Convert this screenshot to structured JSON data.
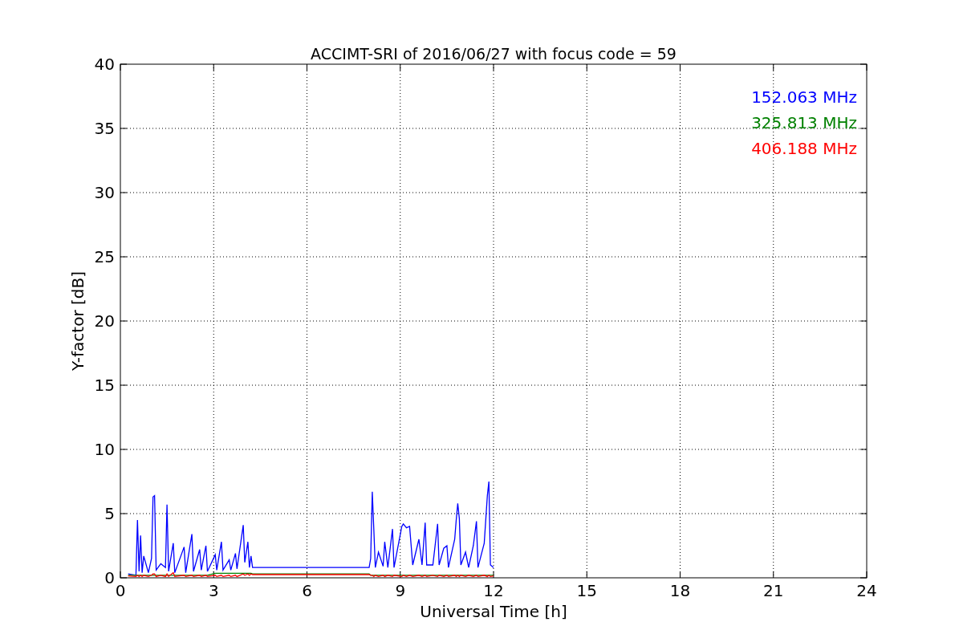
{
  "plot": {
    "chart_data": {
      "type": "line",
      "title": "ACCIMT-SRI of 2016/06/27 with focus code = 59",
      "xlabel": "Universal Time [h]",
      "ylabel": "Y-factor [dB]",
      "x": [
        0.25,
        0.5,
        0.55,
        0.6,
        0.65,
        0.7,
        0.75,
        0.9,
        1.0,
        1.05,
        1.1,
        1.15,
        1.3,
        1.45,
        1.5,
        1.55,
        1.7,
        1.75,
        2.05,
        2.1,
        2.3,
        2.35,
        2.55,
        2.6,
        2.75,
        2.8,
        3.05,
        3.1,
        3.25,
        3.3,
        3.5,
        3.55,
        3.7,
        3.75,
        3.95,
        4.0,
        4.1,
        4.15,
        4.2,
        4.25,
        8.0,
        8.05,
        8.1,
        8.15,
        8.2,
        8.3,
        8.45,
        8.5,
        8.6,
        8.75,
        8.8,
        9.05,
        9.1,
        9.2,
        9.3,
        9.4,
        9.6,
        9.7,
        9.8,
        9.85,
        10.05,
        10.2,
        10.25,
        10.4,
        10.5,
        10.55,
        10.75,
        10.8,
        10.85,
        10.9,
        10.95,
        11.1,
        11.2,
        11.35,
        11.45,
        11.5,
        11.7,
        11.8,
        11.85,
        11.9,
        12.0
      ],
      "series": [
        {
          "name": "152.063 MHz",
          "color": "#0000ff",
          "values": [
            0.3,
            0.2,
            4.5,
            0.5,
            3.3,
            0.4,
            1.7,
            0.4,
            1.5,
            6.3,
            6.4,
            0.6,
            1.1,
            0.8,
            5.7,
            0.5,
            2.7,
            0.4,
            2.4,
            0.4,
            3.4,
            0.5,
            2.2,
            0.6,
            2.5,
            0.5,
            1.8,
            0.6,
            2.8,
            0.6,
            1.4,
            0.6,
            1.9,
            0.7,
            4.1,
            1.2,
            2.8,
            0.8,
            1.7,
            0.8,
            0.8,
            1.5,
            6.7,
            3.8,
            0.8,
            2.0,
            0.9,
            2.8,
            0.8,
            3.8,
            0.8,
            4.0,
            4.2,
            3.9,
            4.0,
            1.0,
            3.0,
            1.0,
            4.3,
            1.0,
            1.0,
            4.2,
            1.0,
            2.3,
            2.5,
            0.8,
            3.0,
            4.5,
            5.8,
            4.6,
            1.0,
            2.0,
            0.8,
            2.5,
            4.4,
            0.8,
            2.7,
            6.4,
            7.5,
            1.0,
            0.8
          ]
        },
        {
          "name": "325.813 MHz",
          "color": "#008000",
          "values": [
            0.2,
            0.2,
            0.2,
            0.2,
            0.2,
            0.2,
            0.2,
            0.2,
            0.2,
            0.2,
            0.2,
            0.2,
            0.2,
            0.2,
            0.2,
            0.2,
            0.2,
            0.2,
            0.2,
            0.2,
            0.2,
            0.2,
            0.2,
            0.2,
            0.2,
            0.2,
            0.35,
            0.35,
            0.35,
            0.35,
            0.35,
            0.35,
            0.35,
            0.35,
            0.35,
            0.35,
            0.35,
            0.35,
            0.35,
            0.3,
            0.3,
            0.2,
            0.2,
            0.2,
            0.2,
            0.2,
            0.2,
            0.2,
            0.2,
            0.2,
            0.2,
            0.2,
            0.2,
            0.2,
            0.2,
            0.2,
            0.2,
            0.2,
            0.2,
            0.2,
            0.2,
            0.2,
            0.2,
            0.2,
            0.2,
            0.2,
            0.2,
            0.2,
            0.2,
            0.2,
            0.2,
            0.2,
            0.2,
            0.2,
            0.2,
            0.2,
            0.2,
            0.2,
            0.2,
            0.2,
            0.2
          ]
        },
        {
          "name": "406.188 MHz",
          "color": "#ff0000",
          "values": [
            0.15,
            0.1,
            0.2,
            0.1,
            0.2,
            0.1,
            0.2,
            0.1,
            0.2,
            0.3,
            0.3,
            0.1,
            0.2,
            0.1,
            0.3,
            0.1,
            0.4,
            0.1,
            0.2,
            0.1,
            0.2,
            0.1,
            0.2,
            0.1,
            0.2,
            0.1,
            0.2,
            0.1,
            0.2,
            0.1,
            0.2,
            0.1,
            0.2,
            0.1,
            0.3,
            0.2,
            0.3,
            0.2,
            0.3,
            0.25,
            0.25,
            0.2,
            0.2,
            0.1,
            0.2,
            0.1,
            0.2,
            0.1,
            0.2,
            0.1,
            0.2,
            0.1,
            0.2,
            0.1,
            0.2,
            0.1,
            0.2,
            0.1,
            0.2,
            0.1,
            0.2,
            0.1,
            0.2,
            0.1,
            0.2,
            0.1,
            0.2,
            0.1,
            0.2,
            0.1,
            0.2,
            0.1,
            0.2,
            0.1,
            0.2,
            0.1,
            0.2,
            0.1,
            0.2,
            0.1,
            0.15
          ]
        }
      ],
      "xlim": [
        0,
        24
      ],
      "ylim": [
        0,
        40
      ],
      "xticks": [
        0,
        3,
        6,
        9,
        12,
        15,
        18,
        21,
        24
      ],
      "yticks": [
        0,
        5,
        10,
        15,
        20,
        25,
        30,
        35,
        40
      ],
      "grid": true
    }
  }
}
